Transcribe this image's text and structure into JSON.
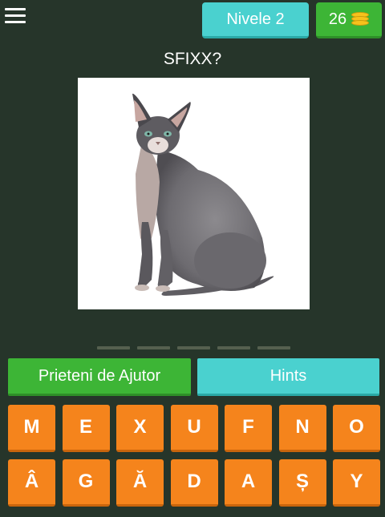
{
  "header": {
    "level_label": "Nivele 2",
    "coins": "26"
  },
  "question": "SFIXX?",
  "picture": {
    "subject": "sphynx-cat"
  },
  "answer_slots": 5,
  "actions": {
    "friends_label": "Prieteni de Ajutor",
    "hints_label": "Hints"
  },
  "keyboard": {
    "letters": [
      "M",
      "E",
      "X",
      "U",
      "F",
      "N",
      "O",
      "Â",
      "G",
      "Ă",
      "D",
      "A",
      "Ș",
      "Y"
    ]
  },
  "colors": {
    "background": "#26352a",
    "teal": "#4ad1cf",
    "green": "#3db536",
    "orange": "#f5841c",
    "coin": "#f6c21c"
  }
}
